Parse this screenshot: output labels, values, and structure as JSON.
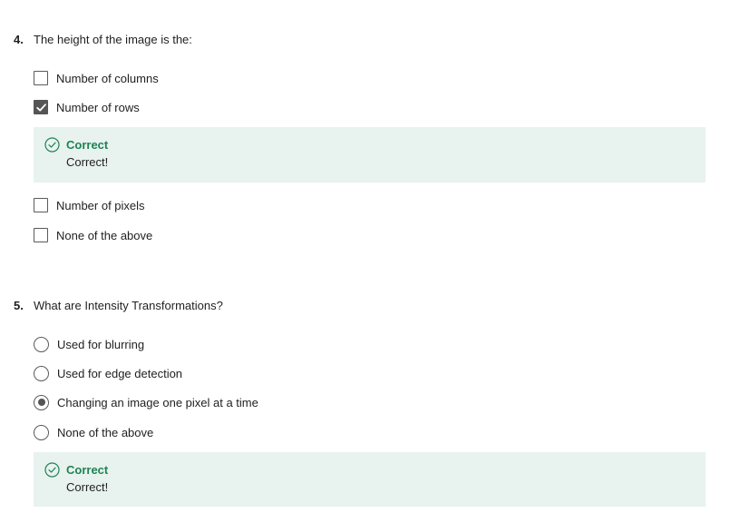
{
  "questions": [
    {
      "number": "4.",
      "text": "The height of the image is the:",
      "options": [
        {
          "label": "Number of columns",
          "checked": false
        },
        {
          "label": "Number of rows",
          "checked": true
        },
        {
          "label": "Number of pixels",
          "checked": false
        },
        {
          "label": "None of the above",
          "checked": false
        }
      ],
      "feedback": {
        "title": "Correct",
        "text": "Correct!"
      }
    },
    {
      "number": "5.",
      "text": "What are Intensity Transformations?",
      "options": [
        {
          "label": "Used for blurring",
          "selected": false
        },
        {
          "label": "Used for edge detection",
          "selected": false
        },
        {
          "label": "Changing an image one pixel at a time",
          "selected": true
        },
        {
          "label": "None of the above",
          "selected": false
        }
      ],
      "feedback": {
        "title": "Correct",
        "text": "Correct!"
      }
    }
  ],
  "colors": {
    "feedback_bg": "#e8f2ee",
    "correct_green": "#1f8354",
    "control_gray": "#555555"
  },
  "icons": {
    "check": "check-icon",
    "correct": "check-circle-icon"
  }
}
